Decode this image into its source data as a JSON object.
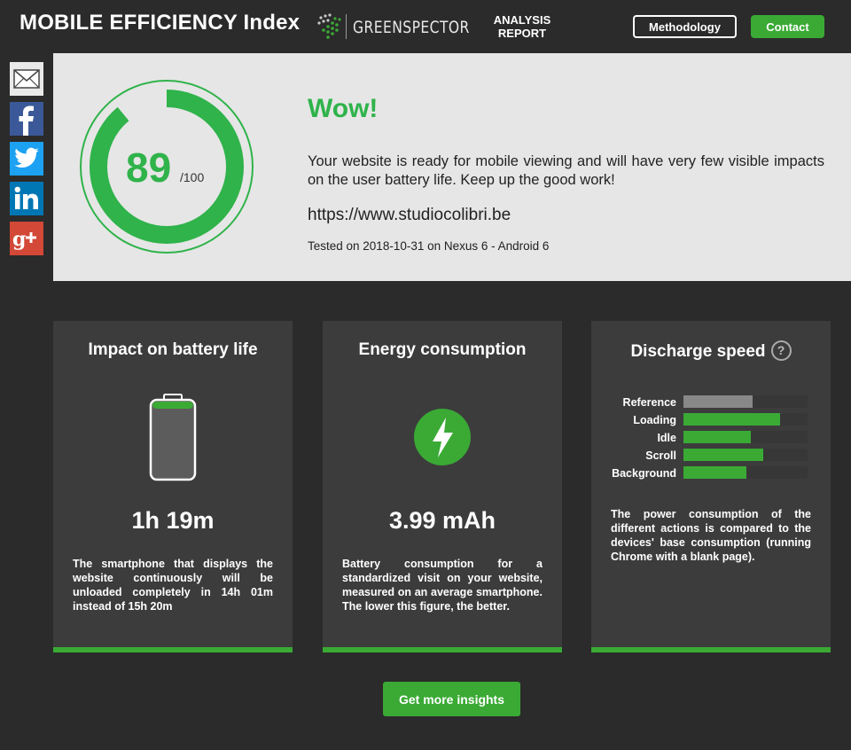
{
  "header": {
    "title": "MOBILE EFFICIENCY Index",
    "brand": "GREENSPECTOR",
    "report_line1": "ANALYSIS",
    "report_line2": "REPORT",
    "methodology": "Methodology",
    "contact": "Contact"
  },
  "social": {
    "icons": [
      "mail-icon",
      "facebook-icon",
      "twitter-icon",
      "linkedin-icon",
      "google-plus-icon"
    ]
  },
  "result": {
    "score": "89",
    "score_max": "/100",
    "score_fraction": 0.89,
    "verdict": "Wow!",
    "description": "Your website is ready for mobile viewing and will have very few visible impacts on the user battery life. Keep up the good work!",
    "url": "https://www.studiocolibri.be",
    "tested": "Tested on 2018-10-31 on Nexus 6 - Android 6"
  },
  "cards": {
    "battery": {
      "title": "Impact on battery life",
      "value": "1h 19m",
      "text": "The smartphone that displays the website continuously will be unloaded completely in 14h 01m instead of 15h 20m",
      "level": 0.08
    },
    "energy": {
      "title": "Energy consumption",
      "value": "3.99 mAh",
      "text": "Battery consumption for a standardized visit on your website, measured on an average smartphone. The lower this figure, the better."
    },
    "discharge": {
      "title": "Discharge speed",
      "help": "?",
      "bars": [
        {
          "label": "Reference",
          "value": 0.56,
          "color": "#888888"
        },
        {
          "label": "Loading",
          "value": 0.78,
          "color": "#3aaa35"
        },
        {
          "label": "Idle",
          "value": 0.54,
          "color": "#3aaa35"
        },
        {
          "label": "Scroll",
          "value": 0.64,
          "color": "#3aaa35"
        },
        {
          "label": "Background",
          "value": 0.51,
          "color": "#3aaa35"
        }
      ],
      "text": "The power consumption of the different actions is compared to the devices' base consumption (running Chrome with a blank page)."
    }
  },
  "cta": "Get more insights",
  "colors": {
    "accent": "#3aaa35",
    "score_green": "#2fb34a",
    "background": "#2b2b2b",
    "card": "#3c3c3c",
    "hero": "#e6e6e6"
  }
}
